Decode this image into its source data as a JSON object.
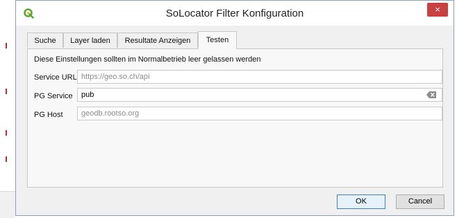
{
  "window": {
    "title": "SoLocator Filter Konfiguration",
    "close_label": "×"
  },
  "icons": {
    "app": "qgis-icon",
    "close": "close-icon",
    "clear": "clear-text-icon"
  },
  "tabs": [
    {
      "label": "Suche",
      "active": false
    },
    {
      "label": "Layer laden",
      "active": false
    },
    {
      "label": "Resultate Anzeigen",
      "active": false
    },
    {
      "label": "Testen",
      "active": true
    }
  ],
  "panel": {
    "notice": "Diese Einstellungen sollten im Normalbetrieb leer gelassen werden",
    "service_url": {
      "label": "Service URL",
      "value": "",
      "placeholder": "https://geo.so.ch/api"
    },
    "pg_service": {
      "label": "PG Service",
      "value": "pub",
      "placeholder": ""
    },
    "pg_host": {
      "label": "PG Host",
      "value": "",
      "placeholder": "geodb.rootso.org"
    }
  },
  "buttons": {
    "ok": "OK",
    "cancel": "Cancel"
  },
  "colors": {
    "close_button": "#c84040",
    "default_button_border": "#3c7fb1",
    "app_icon": "#5fa630"
  }
}
